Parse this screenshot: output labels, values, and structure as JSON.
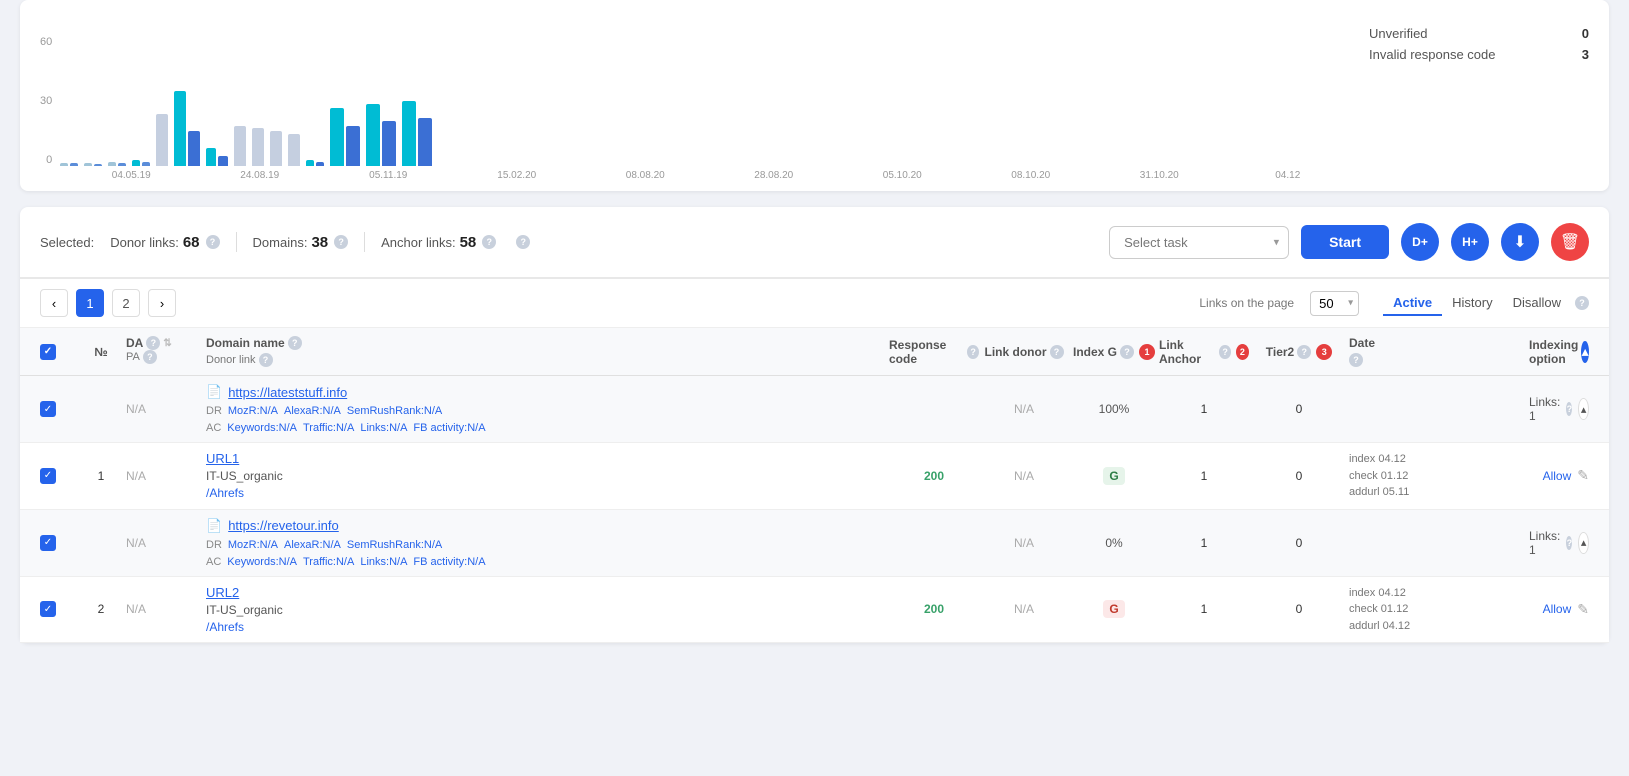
{
  "chart": {
    "y_labels": [
      "60",
      "30",
      "0"
    ],
    "x_labels": [
      "04.05.19",
      "24.08.19",
      "05.11.19",
      "15.02.20",
      "08.08.20",
      "28.08.20",
      "05.10.20",
      "08.10.20",
      "31.10.20",
      "04.12"
    ],
    "right_stats": [
      {
        "label": "Unverified",
        "value": "0"
      },
      {
        "label": "Invalid response code",
        "value": "3"
      }
    ]
  },
  "toolbar": {
    "selected_label": "Selected:",
    "donor_links_label": "Donor links:",
    "donor_links_value": "68",
    "domains_label": "Domains:",
    "domains_value": "38",
    "anchor_links_label": "Anchor links:",
    "anchor_links_value": "58",
    "task_placeholder": "Select task",
    "start_label": "Start"
  },
  "pagination": {
    "prev_label": "‹",
    "next_label": "›",
    "pages": [
      "1",
      "2"
    ],
    "active_page": "1",
    "links_on_page_label": "Links on the page",
    "per_page_value": "50",
    "tabs": [
      "Active",
      "History",
      "Disallow"
    ]
  },
  "table": {
    "headers": {
      "checkbox": "",
      "num": "№",
      "da": "DA",
      "pa": "PA",
      "domain_name": "Domain name",
      "donor_link": "Donor link",
      "response_code": "Response code",
      "link_donor": "Link donor",
      "index_g_label": "Index G",
      "index_g_badge": "1",
      "link_anchor_label": "Link Anchor",
      "link_anchor_badge": "2",
      "tier2_label": "Tier2",
      "tier2_badge": "3",
      "date": "Date",
      "indexing_option": "Indexing option"
    },
    "rows": [
      {
        "type": "group",
        "checkbox": true,
        "num": "",
        "da": "N/A",
        "domain_name": "https://lateststuff.info",
        "domain_url": "https://lateststuff.info",
        "meta_dr": "MozR:N/A",
        "meta_alexa": "AlexaR:N/A",
        "meta_semrush": "SemRushRank:N/A",
        "meta_ac": "AC",
        "meta_keywords": "Keywords:N/A",
        "meta_traffic": "Traffic:N/A",
        "meta_links": "Links:N/A",
        "meta_fb": "FB activity:N/A",
        "response_code": "",
        "link_donor": "N/A",
        "index_g": "100%",
        "link_anchor": "1",
        "tier2": "0",
        "date": "",
        "indexing": "",
        "links_count": "Links: 1",
        "expanded": true
      },
      {
        "type": "detail",
        "checkbox": true,
        "num": "1",
        "da": "N/A",
        "domain_name": "URL1",
        "organic": "IT-US_organic",
        "ahrefs": "/Ahrefs",
        "response_code": "200",
        "link_donor": "N/A",
        "index_g": "G",
        "index_g_green": true,
        "link_anchor": "1",
        "tier2": "0",
        "date_index": "04.12",
        "date_check": "01.12",
        "date_addurl": "05.11",
        "indexing": "Allow",
        "edit": true
      },
      {
        "type": "group",
        "checkbox": true,
        "num": "",
        "da": "N/A",
        "domain_name": "https://revetour.info",
        "domain_url": "https://revetour.info",
        "meta_dr": "MozR:N/A",
        "meta_alexa": "AlexaR:N/A",
        "meta_semrush": "SemRushRank:N/A",
        "meta_ac": "AC",
        "meta_keywords": "Keywords:N/A",
        "meta_traffic": "Traffic:N/A",
        "meta_links": "Links:N/A",
        "meta_fb": "FB activity:N/A",
        "response_code": "",
        "link_donor": "N/A",
        "index_g": "0%",
        "link_anchor": "1",
        "tier2": "0",
        "date": "",
        "indexing": "",
        "links_count": "Links: 1",
        "expanded": true
      },
      {
        "type": "detail",
        "checkbox": true,
        "num": "2",
        "da": "N/A",
        "domain_name": "URL2",
        "organic": "IT-US_organic",
        "ahrefs": "/Ahrefs",
        "response_code": "200",
        "link_donor": "N/A",
        "index_g": "G",
        "index_g_green": false,
        "link_anchor": "1",
        "tier2": "0",
        "date_index": "04.12",
        "date_check": "01.12",
        "date_addurl": "04.12",
        "indexing": "Allow",
        "edit": true
      }
    ]
  },
  "icons": {
    "check": "✓",
    "chevron_down": "▾",
    "chevron_left": "‹",
    "chevron_right": "›",
    "chevron_up": "▴",
    "edit": "✎",
    "d_plus": "D+",
    "h_plus": "H+",
    "download": "⬇",
    "trash": "🗑",
    "doc": "📄"
  }
}
